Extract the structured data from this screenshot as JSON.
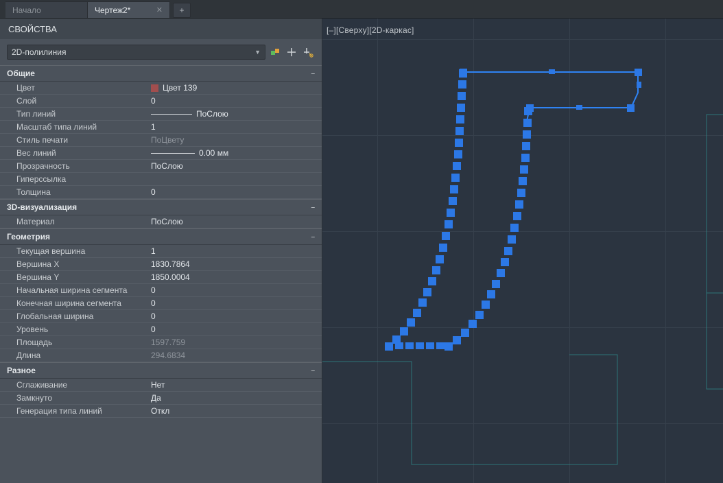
{
  "tabs": {
    "items": [
      {
        "label": "Начало",
        "active": false
      },
      {
        "label": "Чертеж2*",
        "active": true
      }
    ],
    "new_tab": "+"
  },
  "properties": {
    "title": "СВОЙСТВА",
    "entity_type": "2D-полилиния",
    "sections": {
      "general": {
        "title": "Общие",
        "color_label": "Цвет",
        "color_value": "Цвет 139",
        "layer_label": "Слой",
        "layer_value": "0",
        "linetype_label": "Тип линий",
        "linetype_value": "ПоСлою",
        "ltscale_label": "Масштаб типа линий",
        "ltscale_value": "1",
        "plotstyle_label": "Стиль печати",
        "plotstyle_value": "ПоЦвету",
        "lineweight_label": "Вес линий",
        "lineweight_value": "0.00 мм",
        "transparency_label": "Прозрачность",
        "transparency_value": "ПоСлою",
        "hyperlink_label": "Гиперссылка",
        "hyperlink_value": "",
        "thickness_label": "Толщина",
        "thickness_value": "0"
      },
      "viz3d": {
        "title": "3D-визуализация",
        "material_label": "Материал",
        "material_value": "ПоСлою"
      },
      "geometry": {
        "title": "Геометрия",
        "cur_vertex_label": "Текущая вершина",
        "cur_vertex_value": "1",
        "vx_label": "Вершина X",
        "vx_value": "1830.7864",
        "vy_label": "Вершина Y",
        "vy_value": "1850.0004",
        "sw_label": "Начальная ширина сегмента",
        "sw_value": "0",
        "ew_label": "Конечная ширина сегмента",
        "ew_value": "0",
        "gw_label": "Глобальная ширина",
        "gw_value": "0",
        "elev_label": "Уровень",
        "elev_value": "0",
        "area_label": "Площадь",
        "area_value": "1597.759",
        "len_label": "Длина",
        "len_value": "294.6834"
      },
      "misc": {
        "title": "Разное",
        "smooth_label": "Сглаживание",
        "smooth_value": "Нет",
        "closed_label": "Замкнуто",
        "closed_value": "Да",
        "ltgen_label": "Генерация типа линий",
        "ltgen_value": "Откл"
      }
    }
  },
  "viewport": {
    "label_parts": [
      "[–]",
      "[Сверху]",
      "[2D-каркас]"
    ]
  }
}
